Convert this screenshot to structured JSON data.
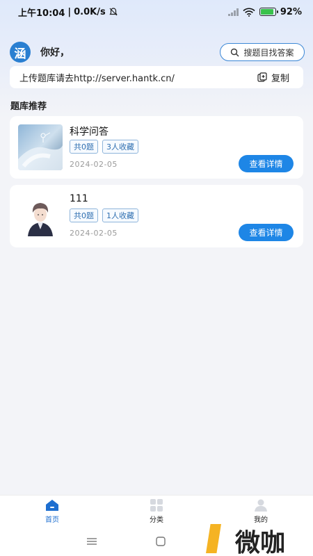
{
  "status_bar": {
    "time": "上午10:04",
    "separator": "|",
    "speed": "0.0K/s",
    "battery": "92%",
    "battery_level": 0.92
  },
  "header": {
    "logo_char": "涵",
    "greeting": "你好，",
    "search_label": "搜题目找答案"
  },
  "upload": {
    "text": "上传题库请去http://server.hantk.cn/",
    "copy_label": "复制"
  },
  "section": {
    "title": "题库推荐"
  },
  "cards": [
    {
      "title": "科学问答",
      "tags": [
        "共0题",
        "3人收藏"
      ],
      "date": "2024-02-05",
      "button": "查看详情"
    },
    {
      "title": "111",
      "tags": [
        "共0题",
        "1人收藏"
      ],
      "date": "2024-02-05",
      "button": "查看详情"
    }
  ],
  "bottom_nav": [
    {
      "label": "首页",
      "icon": "home-icon",
      "active": true
    },
    {
      "label": "分类",
      "icon": "grid-icon",
      "active": false
    },
    {
      "label": "我的",
      "icon": "user-icon",
      "active": false
    }
  ],
  "watermark": "微咖",
  "colors": {
    "accent": "#1e86e6",
    "tag_text": "#2f6fb0",
    "logo_bg": "#2a7fd1"
  }
}
